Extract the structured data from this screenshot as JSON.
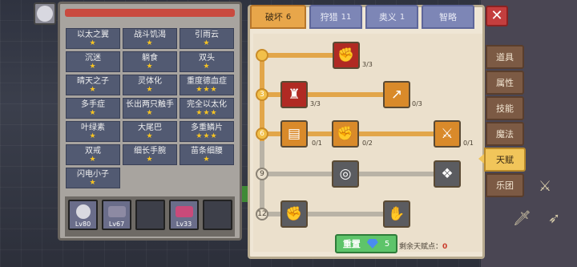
{
  "left_panel": {
    "traits": [
      {
        "name": "以太之翼",
        "stars": "★"
      },
      {
        "name": "战斗饥渴",
        "stars": "★"
      },
      {
        "name": "引雨云",
        "stars": "★"
      },
      {
        "name": "沉迷",
        "stars": "★"
      },
      {
        "name": "躺食",
        "stars": "★"
      },
      {
        "name": "双头",
        "stars": "★"
      },
      {
        "name": "晴天之子",
        "stars": "★"
      },
      {
        "name": "灵体化",
        "stars": "★"
      },
      {
        "name": "重度德血症",
        "stars": "★★★"
      },
      {
        "name": "多手症",
        "stars": "★"
      },
      {
        "name": "长出两只触手",
        "stars": "★"
      },
      {
        "name": "完全以太化",
        "stars": "★★★"
      },
      {
        "name": "叶绿素",
        "stars": "★"
      },
      {
        "name": "大尾巴",
        "stars": "★"
      },
      {
        "name": "多重鳞片",
        "stars": "★★★"
      },
      {
        "name": "双戒",
        "stars": "★"
      },
      {
        "name": "细长手腕",
        "stars": "★"
      },
      {
        "name": "苗条细腰",
        "stars": "★"
      },
      {
        "name": "闪电小子",
        "stars": "★"
      }
    ],
    "party": [
      {
        "level": "Lv80"
      },
      {
        "level": "Lv67"
      },
      {
        "level": ""
      },
      {
        "level": "Lv33"
      },
      {
        "level": ""
      }
    ]
  },
  "tabs": [
    {
      "label": "破坏",
      "count": "6"
    },
    {
      "label": "狩猎",
      "count": "11"
    },
    {
      "label": "奥义",
      "count": "1"
    },
    {
      "label": "智略",
      "count": ""
    }
  ],
  "tree": {
    "levels": [
      "3",
      "6",
      "9",
      "12"
    ],
    "nodes": [
      {
        "count": "3/3",
        "icon": "handshake-icon"
      },
      {
        "count": "3/3",
        "icon": "muscle-icon"
      },
      {
        "count": "0/3",
        "icon": "sword-swing-icon"
      },
      {
        "count": "0/1",
        "icon": "scroll-icon"
      },
      {
        "count": "0/2",
        "icon": "punch-icon"
      },
      {
        "count": "0/1",
        "icon": "slash-icon"
      }
    ]
  },
  "reset": {
    "label": "重置",
    "cost": "5"
  },
  "remaining": {
    "label": "剩余天赋点：",
    "value": "0"
  },
  "side_tabs": [
    "道具",
    "属性",
    "技能",
    "魔法",
    "天赋",
    "乐团"
  ],
  "colors": {
    "accent": "#e8a64a",
    "active_side": "#f1c55a",
    "reset": "#5ec46a"
  }
}
